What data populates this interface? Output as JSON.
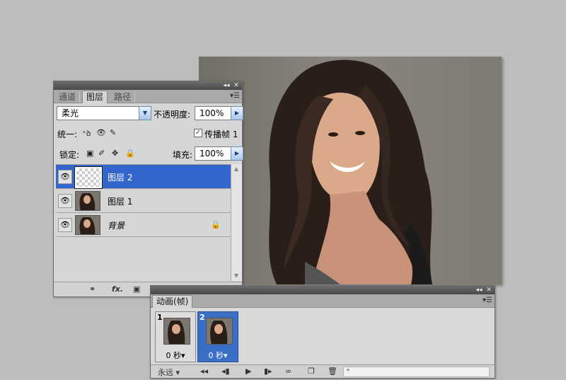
{
  "layers_panel": {
    "tabs": [
      "通道",
      "图层",
      "路径"
    ],
    "active_tab": 1,
    "blend_mode": "柔光",
    "opacity_label": "不透明度:",
    "opacity_value": "100%",
    "unify_label": "统一:",
    "propagate_label": "传播帧 1",
    "propagate_checked": true,
    "lock_label": "锁定:",
    "fill_label": "填充:",
    "fill_value": "100%",
    "layers": [
      {
        "name": "图层 2",
        "selected": true,
        "thumb": "transparent"
      },
      {
        "name": "图层 1",
        "selected": false,
        "thumb": "photo"
      },
      {
        "name": "背景",
        "selected": false,
        "thumb": "photo",
        "locked": true
      }
    ],
    "footer_icons": [
      "link-icon",
      "fx-icon",
      "mask-icon",
      "adjustment-icon",
      "new-group-icon",
      "new-layer-icon",
      "trash-icon"
    ],
    "fx_text": "fx."
  },
  "animation_panel": {
    "tab_label": "动画(帧)",
    "frames": [
      {
        "number": "1",
        "delay": "0 秒▾",
        "selected": false
      },
      {
        "number": "2",
        "delay": "0 秒▾",
        "selected": true
      }
    ],
    "loop_label": "永远",
    "controls": [
      "first-frame-icon",
      "prev-frame-icon",
      "play-icon",
      "next-frame-icon",
      "tween-icon",
      "duplicate-frame-icon",
      "delete-frame-icon"
    ]
  },
  "colors": {
    "selection": "#3366cc",
    "panel_bg": "#d6d6d6",
    "desktop_bg": "#bdbdbd"
  }
}
